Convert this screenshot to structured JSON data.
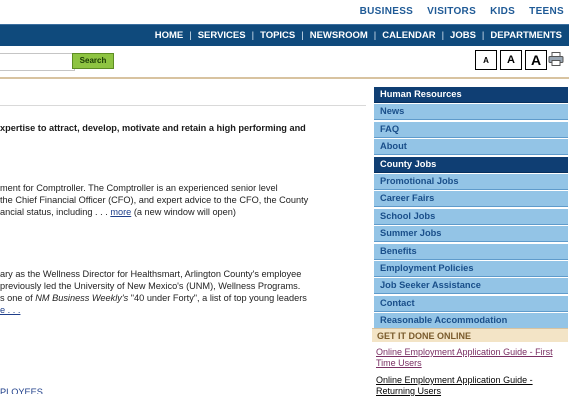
{
  "top_links": [
    "BUSINESS",
    "VISITORS",
    "KIDS",
    "TEENS"
  ],
  "nav": [
    "HOME",
    "SERVICES",
    "TOPICS",
    "NEWSROOM",
    "CALENDAR",
    "JOBS",
    "DEPARTMENTS"
  ],
  "search": {
    "button_label": "Search",
    "value": ""
  },
  "font_sizes": [
    "A",
    "A",
    "A"
  ],
  "content": {
    "intro": "xpertise to attract, develop, motivate and retain a high performing and",
    "comptroller": [
      "ment for Comptroller.  The Comptroller is an experienced senior level",
      " the Chief Financial Officer (CFO), and expert advice to the CFO, the County",
      "ancial status, including . . ."
    ],
    "more_link": "more",
    "more_suffix": " (a new window will open)",
    "wellness": [
      "ary as the Wellness Director for Healthsmart, Arlington County's employee",
      "previously led the University of New Mexico's (UNM), Wellness Programs.",
      "s one of "
    ],
    "wellness_italic": "NM Business Weekly's",
    "wellness_suffix": " \"40 under Forty\", a list of top young leaders",
    "wellness_more": "e . . .",
    "bottom_cut": "PLOYEES"
  },
  "sidebar": {
    "items": [
      {
        "label": "Human Resources",
        "style": "dark"
      },
      {
        "label": "News",
        "style": "light"
      },
      {
        "label": "FAQ",
        "style": "light"
      },
      {
        "label": "About",
        "style": "light"
      },
      {
        "label": "County Jobs",
        "style": "dark"
      },
      {
        "label": "Promotional Jobs",
        "style": "light"
      },
      {
        "label": "Career Fairs",
        "style": "light"
      },
      {
        "label": "School Jobs",
        "style": "light"
      },
      {
        "label": "Summer Jobs",
        "style": "light"
      },
      {
        "label": "Benefits",
        "style": "light"
      },
      {
        "label": "Employment Policies",
        "style": "light"
      },
      {
        "label": "Job Seeker Assistance",
        "style": "light"
      },
      {
        "label": "Contact",
        "style": "light"
      },
      {
        "label": "Reasonable Accommodation",
        "style": "light"
      }
    ]
  },
  "get_it_done": {
    "title": "GET IT DONE ONLINE",
    "links": [
      "Online Employment Application Guide - First Time Users",
      "Online Employment Application Guide - Returning Users"
    ]
  }
}
